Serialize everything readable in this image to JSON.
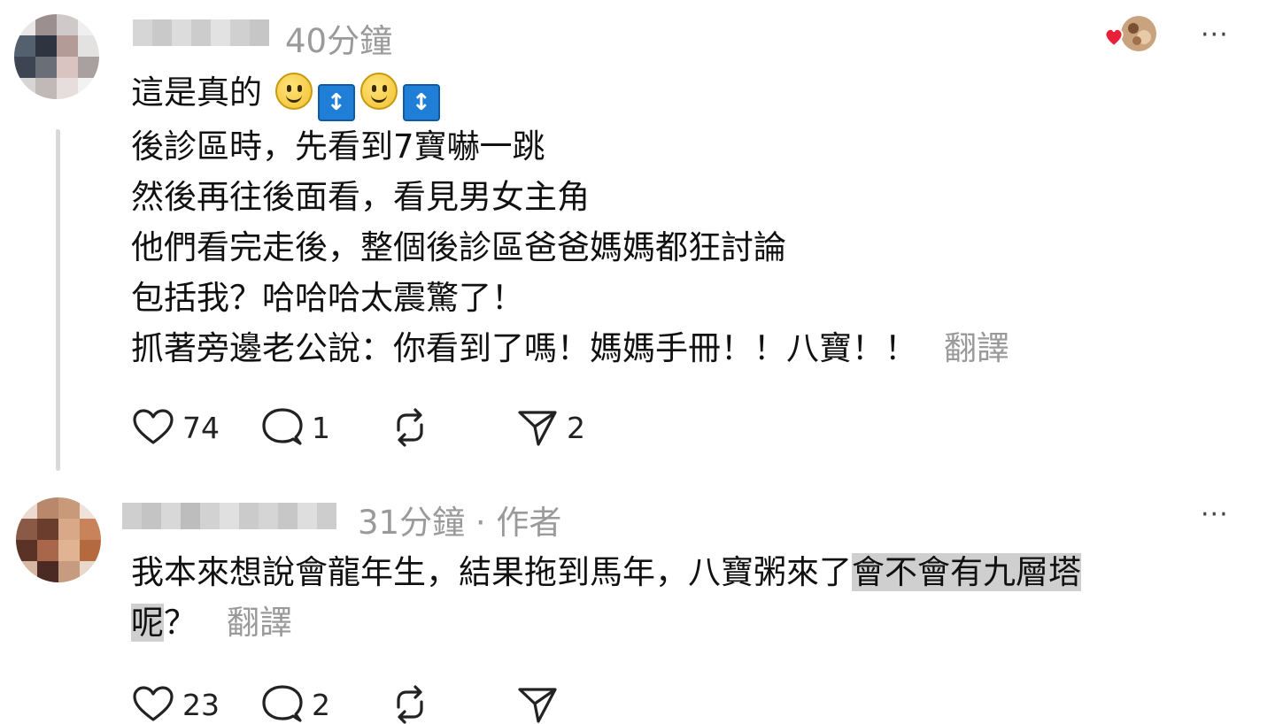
{
  "post1": {
    "time": "40分鐘",
    "lines": [
      "這是真的",
      "後診區時，先看到7寶嚇一跳",
      "然後再往後面看，看見男女主角",
      "他們看完走後，整個後診區爸爸媽媽都狂討論",
      "包括我？哈哈哈太震驚了！",
      "抓著旁邊老公說：你看到了嗎！媽媽手冊！！八寶！！"
    ],
    "translate_label": "翻譯",
    "likes": "74",
    "replies": "1",
    "reposts": "",
    "shares": "2",
    "more_label": "···"
  },
  "post2": {
    "time_author": "31分鐘 · 作者",
    "line1_plain": "我本來想說會龍年生，結果拖到馬年，八寶粥來了",
    "line1_highlight": "會不會有九層塔",
    "line2_highlight": "呢",
    "line2_plain": "？",
    "translate_label": "翻譯",
    "likes": "23",
    "replies": "2",
    "more_label": "···"
  },
  "icons": {
    "like": "heart-outline-icon",
    "reply": "speech-bubble-icon",
    "repost": "repost-arrows-icon",
    "share": "send-plane-icon",
    "liked_by_author": "heart-avatar-badge-icon"
  }
}
